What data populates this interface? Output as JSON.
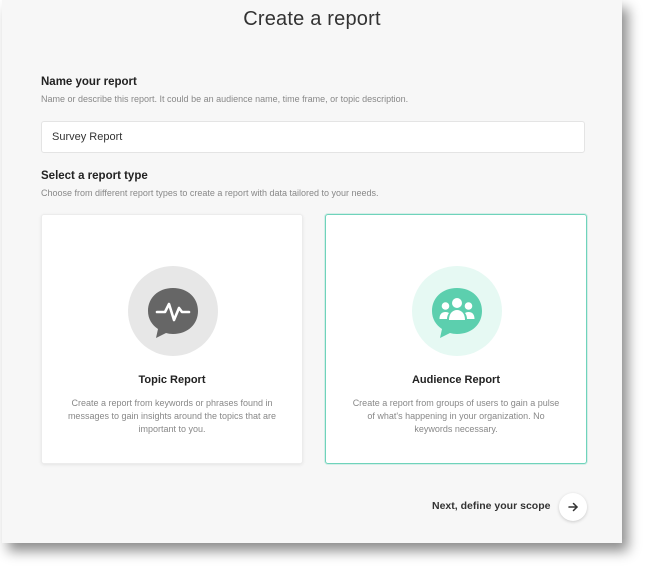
{
  "page": {
    "title": "Create a report"
  },
  "name_section": {
    "label": "Name your report",
    "help": "Name or describe this report. It could be an audience name, time frame, or topic description.",
    "input_value": "Survey Report"
  },
  "type_section": {
    "label": "Select a report type",
    "help": "Choose from different report types to create a report with data tailored to your needs.",
    "cards": [
      {
        "title": "Topic Report",
        "description": "Create a report from keywords or phrases found in messages to gain insights around the topics that are important to you.",
        "icon": "pulse-chat-icon",
        "selected": false
      },
      {
        "title": "Audience Report",
        "description": "Create a report from groups of users to gain a pulse of what's happening in your organization. No keywords necessary.",
        "icon": "group-chat-icon",
        "selected": true
      }
    ]
  },
  "footer": {
    "next_label": "Next, define your scope",
    "next_icon": "arrow-right-icon"
  },
  "colors": {
    "accent": "#5ccfae",
    "accent_light": "#e6f9f3",
    "topic_icon_bg": "#e7e7e7",
    "topic_icon_fg": "#666666"
  }
}
